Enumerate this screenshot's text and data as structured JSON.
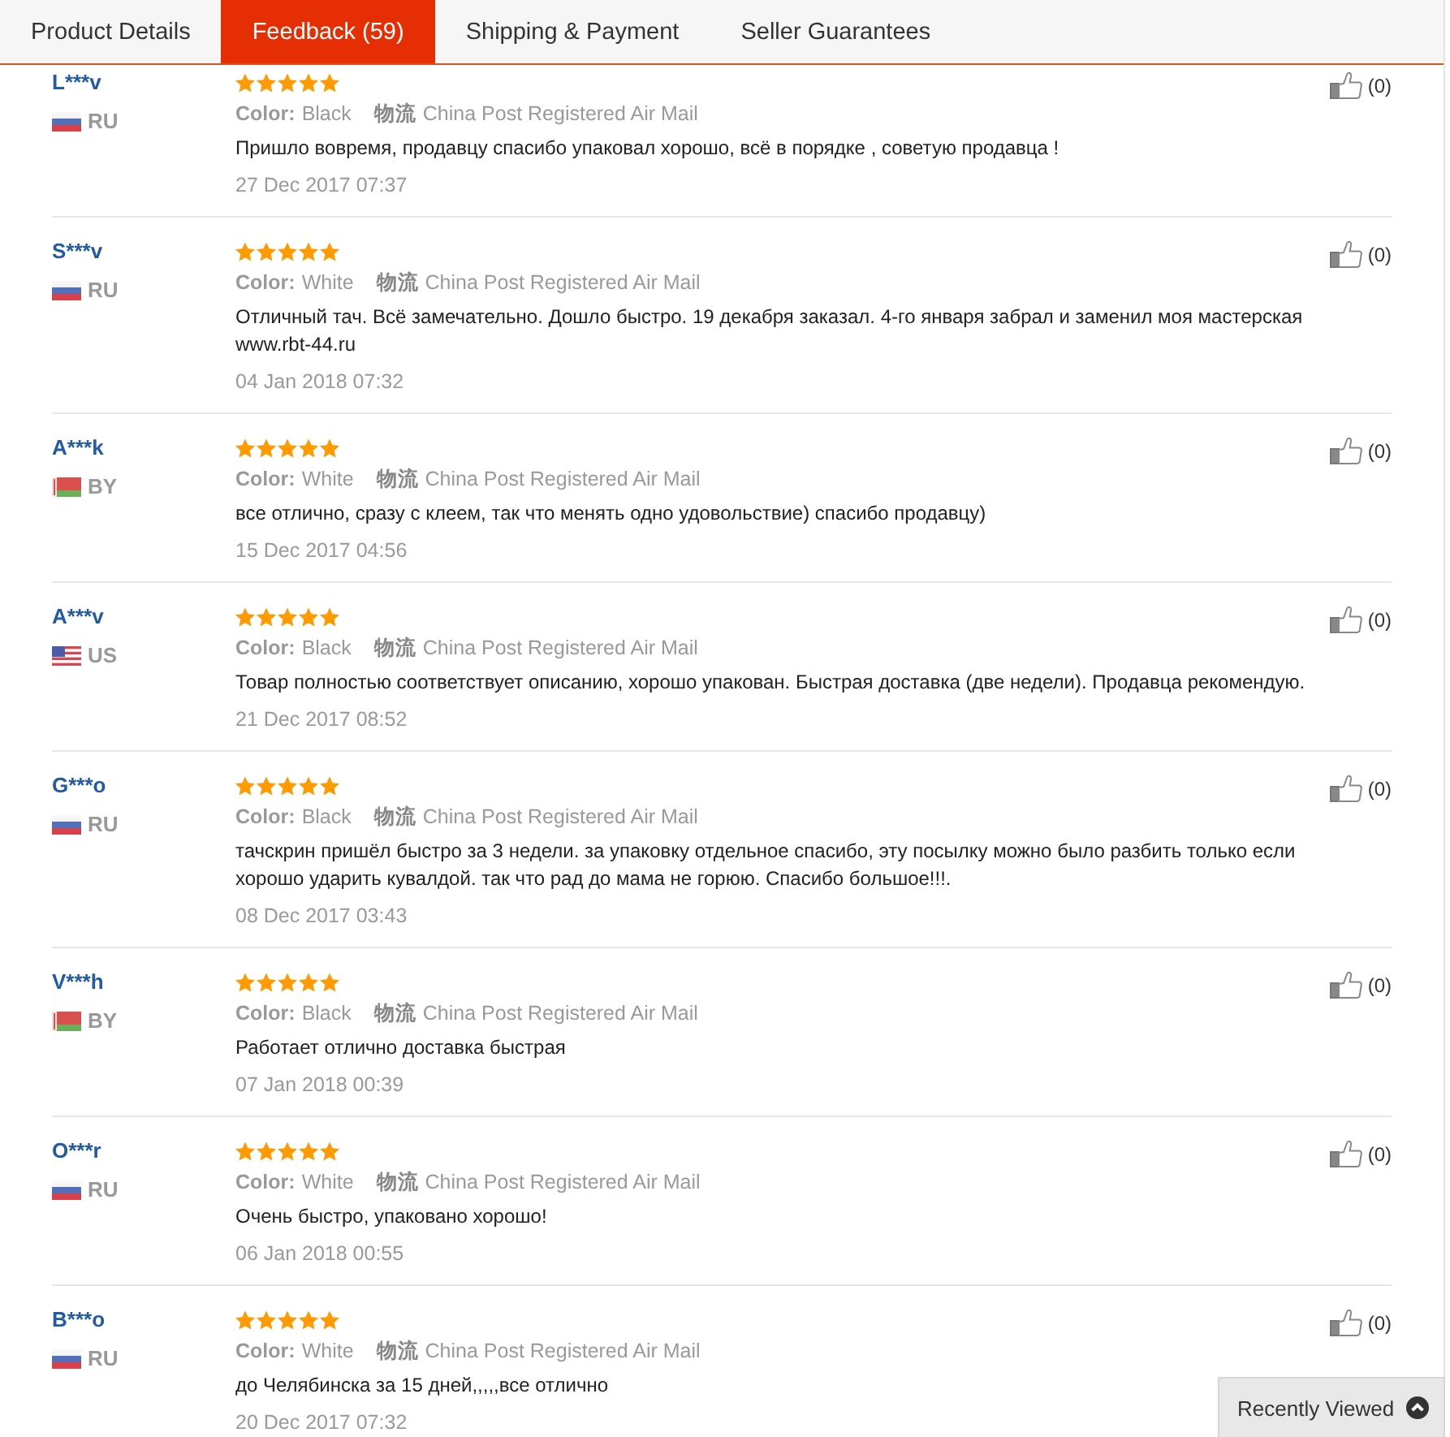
{
  "tabs": [
    {
      "label": "Product Details",
      "selected": false
    },
    {
      "label": "Feedback (59)",
      "selected": true
    },
    {
      "label": "Shipping & Payment",
      "selected": false
    },
    {
      "label": "Seller Guarantees",
      "selected": false
    }
  ],
  "reviews": [
    {
      "name": "L***v",
      "flag": {
        "kind": "ru"
      },
      "country": "RU",
      "stars": 5,
      "color_label": "Color:",
      "color_value": "Black",
      "shipping_label": "物流",
      "shipping_method": "China Post Registered Air Mail",
      "text": "Пришло вовремя, продавцу спасибо упаковал хорошо, всё в порядке , советую продавца !",
      "date": "27 Dec 2017 07:37",
      "likes": "(0)"
    },
    {
      "name": "S***v",
      "flag": {
        "kind": "ru"
      },
      "country": "RU",
      "stars": 5,
      "color_label": "Color:",
      "color_value": "White",
      "shipping_label": "物流",
      "shipping_method": "China Post Registered Air Mail",
      "text": "Отличный тач. Всё замечательно. Дошло быстро. 19 декабря заказал. 4-го января забрал и заменил моя мастерская www.rbt-44.ru",
      "date": "04 Jan 2018 07:32",
      "likes": "(0)"
    },
    {
      "name": "A***k",
      "flag": {
        "kind": "by"
      },
      "country": "BY",
      "stars": 5,
      "color_label": "Color:",
      "color_value": "White",
      "shipping_label": "物流",
      "shipping_method": "China Post Registered Air Mail",
      "text": "все отлично, сразу с клеем, так что менять одно удовольствие) спасибо продавцу)",
      "date": "15 Dec 2017 04:56",
      "likes": "(0)"
    },
    {
      "name": "A***v",
      "flag": {
        "kind": "us"
      },
      "country": "US",
      "stars": 5,
      "color_label": "Color:",
      "color_value": "Black",
      "shipping_label": "物流",
      "shipping_method": "China Post Registered Air Mail",
      "text": "Товар полностью соответствует описанию, хорошо упакован. Быстрая доставка (две недели). Продавца рекомендую.",
      "date": "21 Dec 2017 08:52",
      "likes": "(0)"
    },
    {
      "name": "G***o",
      "flag": {
        "kind": "ru"
      },
      "country": "RU",
      "stars": 5,
      "color_label": "Color:",
      "color_value": "Black",
      "shipping_label": "物流",
      "shipping_method": "China Post Registered Air Mail",
      "text": "тачскрин пришёл быстро за 3 недели. за упаковку отдельное спасибо, эту посылку можно было разбить только если хорошо ударить кувалдой. так что рад до мама не горюю. Спасибо большое!!!.",
      "date": "08 Dec 2017 03:43",
      "likes": "(0)"
    },
    {
      "name": "V***h",
      "flag": {
        "kind": "by"
      },
      "country": "BY",
      "stars": 5,
      "color_label": "Color:",
      "color_value": "Black",
      "shipping_label": "物流",
      "shipping_method": "China Post Registered Air Mail",
      "text": "Работает отлично доставка быстрая",
      "date": "07 Jan 2018 00:39",
      "likes": "(0)"
    },
    {
      "name": "O***r",
      "flag": {
        "kind": "ru"
      },
      "country": "RU",
      "stars": 5,
      "color_label": "Color:",
      "color_value": "White",
      "shipping_label": "物流",
      "shipping_method": "China Post Registered Air Mail",
      "text": "Очень быстро, упаковано хорошо!",
      "date": "06 Jan 2018 00:55",
      "likes": "(0)"
    },
    {
      "name": "B***o",
      "flag": {
        "kind": "ru"
      },
      "country": "RU",
      "stars": 5,
      "color_label": "Color:",
      "color_value": "White",
      "shipping_label": "物流",
      "shipping_method": "China Post Registered Air Mail",
      "text": "до Челябинска за 15 дней,,,,,все отлично",
      "date": "20 Dec 2017 07:32",
      "likes": "(0)"
    }
  ],
  "recently_viewed": {
    "label": "Recently Viewed"
  }
}
